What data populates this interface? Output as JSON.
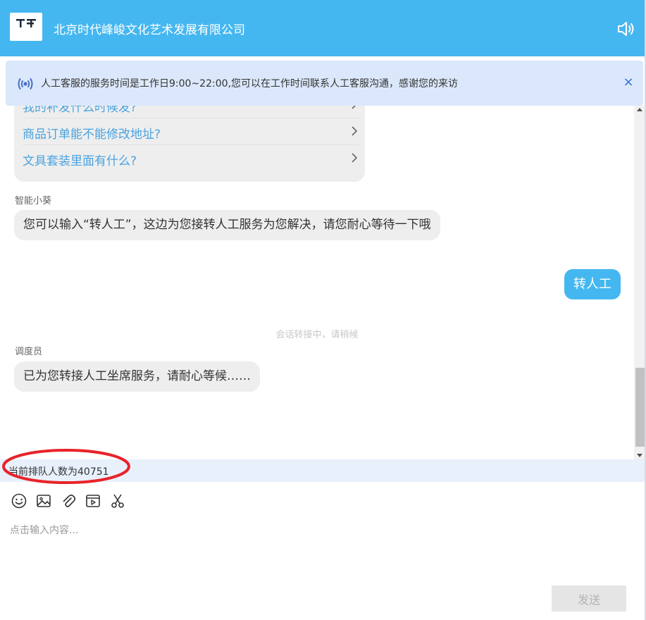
{
  "header": {
    "logo_text": "TF FAMILY",
    "company_name": "北京时代峰峻文化艺术发展有限公司"
  },
  "notice": {
    "text": "人工客服的服务时间是工作日9:00~22:00,您可以在工作时间联系人工客服沟通，感谢您的来访",
    "close_glyph": "×"
  },
  "chat": {
    "faq_items": [
      {
        "label": "我的补发什么时候发?"
      },
      {
        "label": "商品订单能不能修改地址?"
      },
      {
        "label": "文具套装里面有什么?"
      }
    ],
    "messages": [
      {
        "sender": "智能小葵",
        "text": "您可以输入“转人工”，这边为您接转人工服务为您解决，请您耐心等待一下哦"
      },
      {
        "sender": "",
        "text": "转人工"
      },
      {
        "system": "会话转接中，请稍候"
      },
      {
        "sender": "调度员",
        "text": "已为您转接人工坐席服务，请耐心等候……"
      }
    ]
  },
  "queue": {
    "text": "当前排队人数为40751"
  },
  "composer": {
    "placeholder": "点击输入内容...",
    "value": "",
    "send_label": "发送"
  },
  "colors": {
    "brand": "#45b7f0",
    "notice_bg": "#dbe8fb",
    "queue_bg": "#e8f0fc",
    "annotation": "#e8232a",
    "link": "#4aa3e0"
  }
}
